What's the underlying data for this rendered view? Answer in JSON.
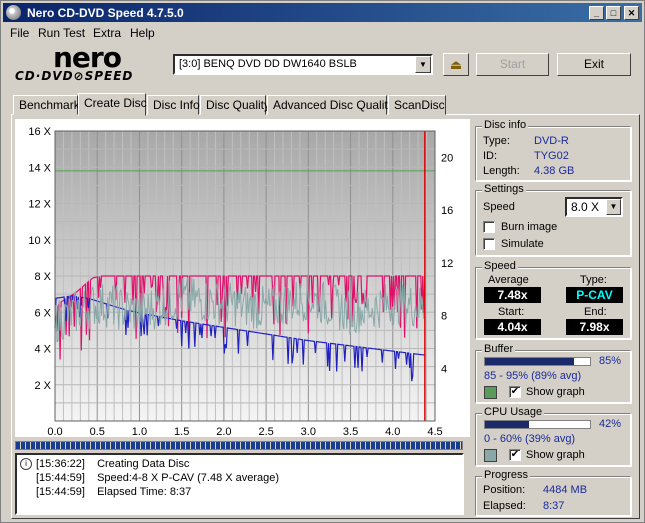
{
  "window": {
    "title": "Nero CD-DVD Speed 4.7.5.0",
    "minimize_glyph": "_",
    "maximize_glyph": "□",
    "close_glyph": "✕"
  },
  "menu": [
    "File",
    "Run Test",
    "Extra",
    "Help"
  ],
  "logo": {
    "brand": "nero",
    "product": "CD·DVD⊘SPEED"
  },
  "drive": {
    "selected": "[3:0]   BENQ DVD DD DW1640 BSLB"
  },
  "toolbar": {
    "start_label": "Start",
    "exit_label": "Exit"
  },
  "tabs": [
    "Benchmark",
    "Create Disc",
    "Disc Info",
    "Disc Quality",
    "Advanced Disc Quality",
    "ScanDisc"
  ],
  "active_tab": "Create Disc",
  "disc_info": {
    "title": "Disc info",
    "type_label": "Type:",
    "type_value": "DVD-R",
    "id_label": "ID:",
    "id_value": "TYG02",
    "length_label": "Length:",
    "length_value": "4.38 GB"
  },
  "settings": {
    "title": "Settings",
    "speed_label": "Speed",
    "speed_value": "8.0 X",
    "burn_image_label": "Burn image",
    "simulate_label": "Simulate"
  },
  "speed": {
    "title": "Speed",
    "average_label": "Average",
    "average_value": "7.48x",
    "type_label": "Type:",
    "type_value": "P-CAV",
    "start_label": "Start:",
    "start_value": "4.04x",
    "end_label": "End:",
    "end_value": "7.98x"
  },
  "buffer": {
    "title": "Buffer",
    "percent": 85,
    "percent_text": "85%",
    "range_text": "85 - 95% (89% avg)",
    "show_graph_label": "Show graph",
    "show_graph_checked": "✔",
    "swatch_color": "#5a9a5a"
  },
  "cpu": {
    "title": "CPU Usage",
    "percent": 42,
    "percent_text": "42%",
    "range_text": "0 - 60% (39% avg)",
    "show_graph_label": "Show graph",
    "show_graph_checked": "✔",
    "swatch_color": "#8aa8a8"
  },
  "progress": {
    "title": "Progress",
    "position_label": "Position:",
    "position_value": "4484 MB",
    "elapsed_label": "Elapsed:",
    "elapsed_value": "8:37"
  },
  "log": [
    {
      "time": "[15:36:22]",
      "text": "Creating Data Disc"
    },
    {
      "time": "[15:44:59]",
      "text": "Speed:4-8 X P-CAV (7.48 X average)"
    },
    {
      "time": "[15:44:59]",
      "text": "Elapsed Time:  8:37"
    }
  ],
  "chart_data": {
    "type": "line",
    "x_ticks": [
      "0.0",
      "0.5",
      "1.0",
      "1.5",
      "2.0",
      "2.5",
      "3.0",
      "3.5",
      "4.0",
      "4.5"
    ],
    "xlim": [
      0,
      4.5
    ],
    "y_left_ticks": [
      "2 X",
      "4 X",
      "6 X",
      "8 X",
      "10 X",
      "12 X",
      "14 X",
      "16 X"
    ],
    "ylim_left": [
      0,
      16
    ],
    "y_right_ticks": [
      "4",
      "8",
      "12",
      "16",
      "20"
    ],
    "ylim_right": [
      0,
      22
    ],
    "end_marker_x": 4.38,
    "reference_line_y": 13.8,
    "grid": true,
    "colors": {
      "write_speed": "#e0106a",
      "rpm": "#2020c0",
      "buffer": "#5a9a5a",
      "cpu": "#8aa8a8",
      "end_marker": "#e00000",
      "reference": "#50a050"
    },
    "series": [
      {
        "key": "write_speed",
        "x": [
          0.0,
          0.05,
          0.15,
          0.25,
          0.35,
          0.45,
          0.55,
          0.65,
          0.75,
          0.85,
          0.95,
          1.2,
          1.5,
          2.0,
          2.5,
          3.0,
          3.5,
          4.0,
          4.38
        ],
        "values": [
          5.9,
          6.5,
          6.8,
          7.1,
          7.5,
          7.9,
          8.0,
          8.0,
          8.0,
          8.0,
          8.0,
          8.0,
          8.0,
          8.0,
          8.0,
          8.0,
          8.0,
          8.0,
          8.0
        ]
      },
      {
        "key": "rpm",
        "x": [
          0.0,
          0.2,
          0.4,
          0.6,
          0.8,
          1.0,
          1.5,
          2.0,
          2.5,
          3.0,
          3.5,
          4.0,
          4.38
        ],
        "values": [
          9.3,
          9.5,
          9.3,
          8.9,
          8.5,
          8.2,
          7.6,
          7.1,
          6.6,
          6.1,
          5.7,
          5.3,
          5.0
        ]
      },
      {
        "key": "cpu",
        "x": [
          0.0,
          0.5,
          1.0,
          1.5,
          2.0,
          2.5,
          3.0,
          3.5,
          4.0,
          4.38
        ],
        "values": [
          5.5,
          6.5,
          6.0,
          6.8,
          6.5,
          6.2,
          6.8,
          6.0,
          6.5,
          6.3
        ]
      }
    ]
  }
}
